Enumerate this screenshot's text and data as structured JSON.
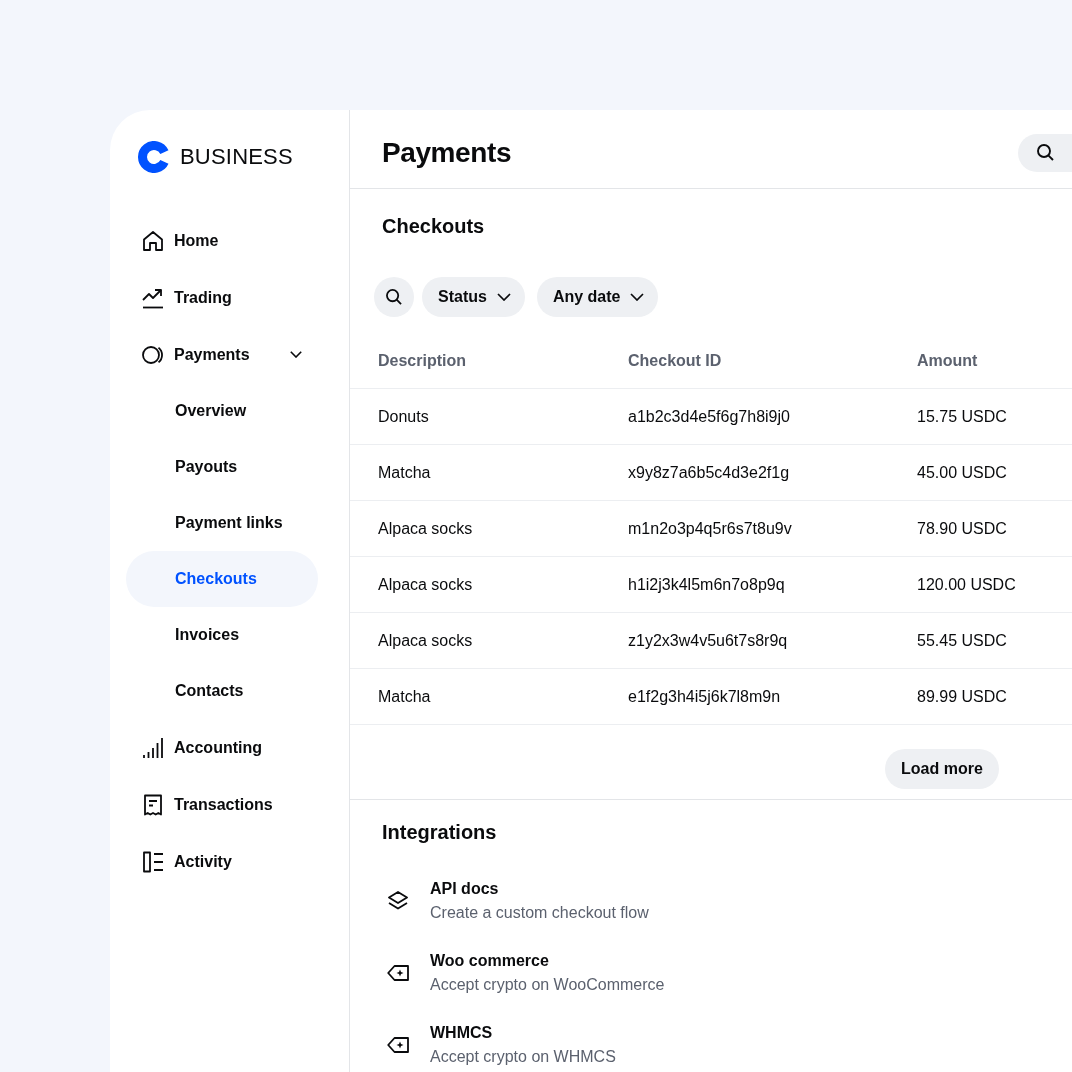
{
  "logo": {
    "text": "BUSINESS"
  },
  "sidebar": {
    "items": [
      {
        "label": "Home",
        "selected": false
      },
      {
        "label": "Trading",
        "selected": false
      },
      {
        "label": "Payments",
        "selected": false,
        "expanded": true,
        "children": [
          {
            "label": "Overview",
            "selected": false
          },
          {
            "label": "Payouts",
            "selected": false
          },
          {
            "label": "Payment links",
            "selected": false
          },
          {
            "label": "Checkouts",
            "selected": true
          },
          {
            "label": "Invoices",
            "selected": false
          },
          {
            "label": "Contacts",
            "selected": false
          }
        ]
      },
      {
        "label": "Accounting",
        "selected": false
      },
      {
        "label": "Transactions",
        "selected": false
      },
      {
        "label": "Activity",
        "selected": false
      }
    ]
  },
  "header": {
    "title": "Payments"
  },
  "checkouts": {
    "title": "Checkouts",
    "filters": [
      {
        "label": "Status"
      },
      {
        "label": "Any date"
      }
    ],
    "table": {
      "columns": [
        "Description",
        "Checkout ID",
        "Amount"
      ],
      "rows": [
        {
          "description": "Donuts",
          "checkout_id": "a1b2c3d4e5f6g7h8i9j0",
          "amount": "15.75 USDC"
        },
        {
          "description": "Matcha",
          "checkout_id": "x9y8z7a6b5c4d3e2f1g",
          "amount": "45.00 USDC"
        },
        {
          "description": "Alpaca socks",
          "checkout_id": "m1n2o3p4q5r6s7t8u9v",
          "amount": "78.90 USDC"
        },
        {
          "description": "Alpaca socks",
          "checkout_id": "h1i2j3k4l5m6n7o8p9q",
          "amount": "120.00 USDC"
        },
        {
          "description": "Alpaca socks",
          "checkout_id": "z1y2x3w4v5u6t7s8r9q",
          "amount": "55.45 USDC"
        },
        {
          "description": "Matcha",
          "checkout_id": "e1f2g3h4i5j6k7l8m9n",
          "amount": "89.99 USDC"
        }
      ]
    },
    "load_more": "Load more"
  },
  "integrations": {
    "title": "Integrations",
    "items": [
      {
        "title": "API docs",
        "subtitle": "Create a custom checkout flow"
      },
      {
        "title": "Woo commerce",
        "subtitle": "Accept crypto on WooCommerce"
      },
      {
        "title": "WHMCS",
        "subtitle": "Accept crypto on WHMCS"
      }
    ]
  }
}
